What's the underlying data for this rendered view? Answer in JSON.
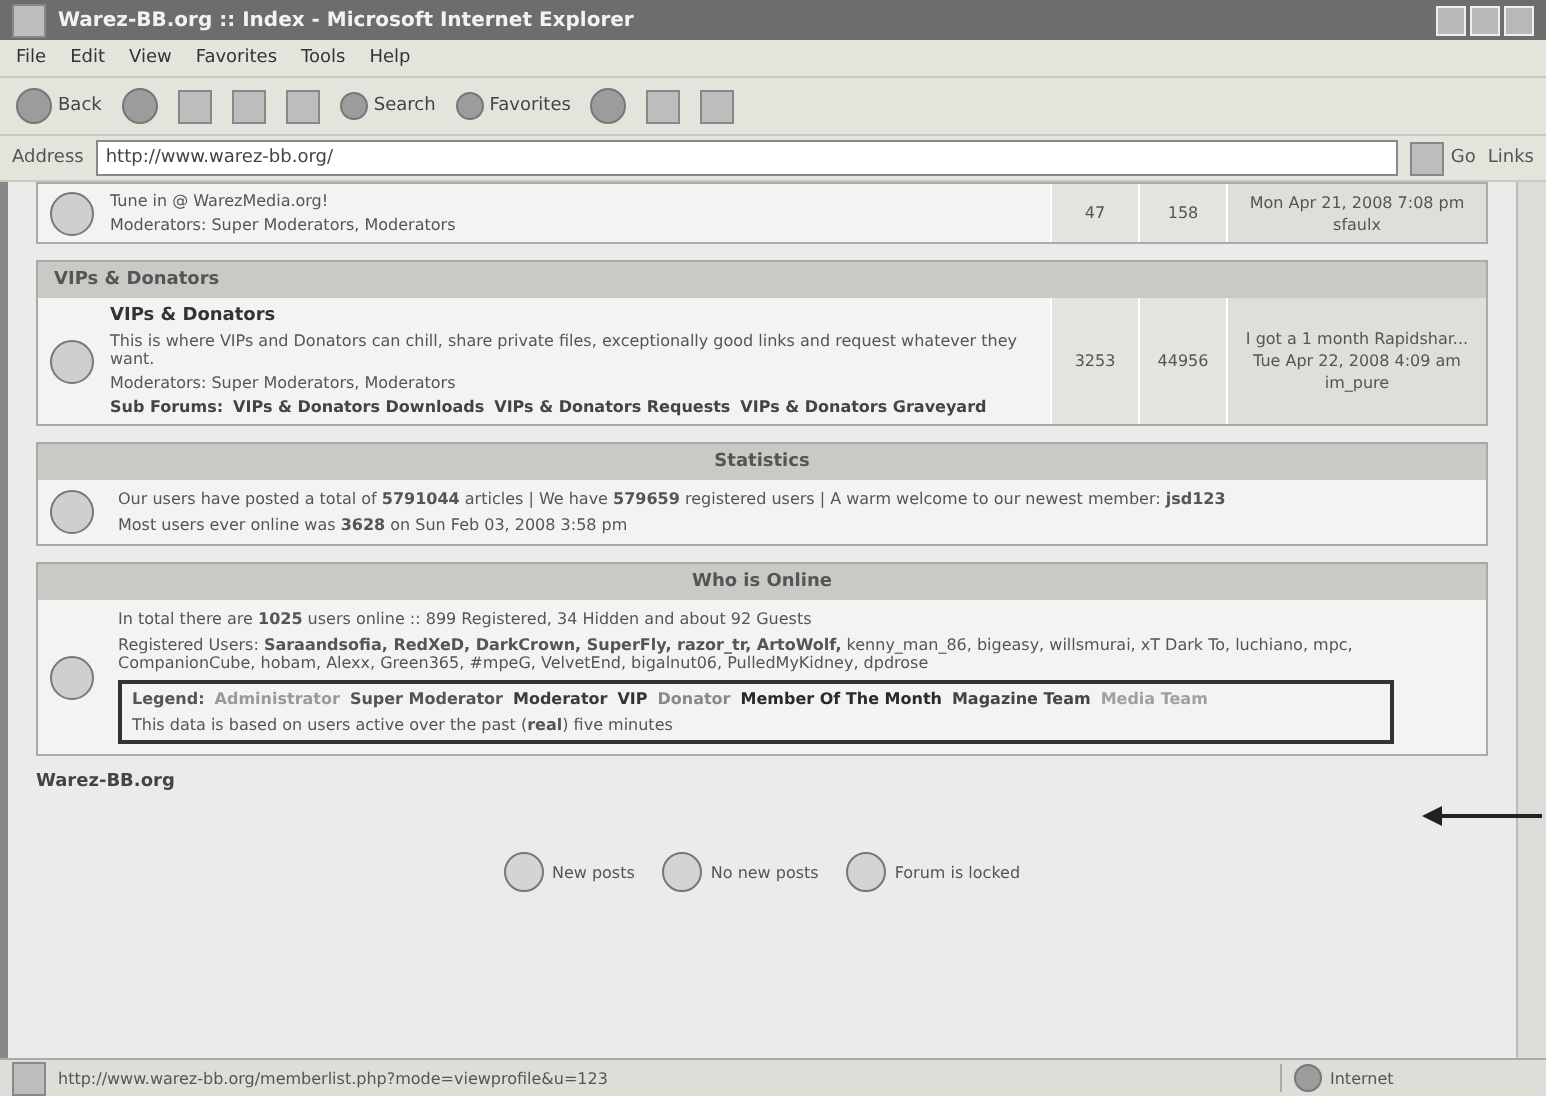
{
  "window": {
    "title": "Warez-BB.org :: Index - Microsoft Internet Explorer"
  },
  "menu": [
    "File",
    "Edit",
    "View",
    "Favorites",
    "Tools",
    "Help"
  ],
  "toolbar": {
    "back": "Back",
    "search": "Search",
    "favorites": "Favorites"
  },
  "address_bar": {
    "label": "Address",
    "value": "http://www.warez-bb.org/",
    "go": "Go",
    "links": "Links"
  },
  "partial_forum": {
    "description": "Tune in @ WarezMedia.org!",
    "moderators": "Moderators: Super Moderators, Moderators",
    "topics": "47",
    "posts": "158",
    "last_post_date": "Mon Apr 21, 2008 7:08 pm",
    "last_post_user": "sfaulx"
  },
  "category": {
    "title": "VIPs & Donators"
  },
  "forum": {
    "name": "VIPs & Donators",
    "description": "This is where VIPs and Donators can chill, share private files, exceptionally good links and request whatever they want.",
    "moderators": "Moderators: Super Moderators, Moderators",
    "sub_label": "Sub Forums:",
    "sub_forums": [
      "VIPs & Donators Downloads",
      "VIPs & Donators Requests",
      "VIPs & Donators Graveyard"
    ],
    "topics": "3253",
    "posts": "44956",
    "last_post_title": "I got a 1 month Rapidshar...",
    "last_post_date": "Tue Apr 22, 2008 4:09 am",
    "last_post_user": "im_pure"
  },
  "statistics": {
    "title": "Statistics",
    "lines": [
      "Our users have posted a total of **5791044** articles | We have **579659** registered users | A warm welcome to our newest member: **jsd123**",
      "Most users ever online was **3628** on Sun Feb 03, 2008 3:58 pm"
    ]
  },
  "who_is_online": {
    "title": "Who is Online",
    "total": "In total there are **1025** users online :: 899 Registered, 34 Hidden and about 92 Guests",
    "registered": "Registered Users: **Saraandsofia, RedXeD, DarkCrown, SuperFly, razor_tr, ArtoWolf,** kenny_man_86, bigeasy, willsmurai, xT Dark To, luchiano, mpc, CompanionCube, hobam, Alexx, Green365, #mpeG, VelvetEnd, bigalnut06, PulledMyKidney, dpdrose",
    "legend_label": "Legend:",
    "legend": [
      {
        "label": "Administrator",
        "color": "#9a9a9a"
      },
      {
        "label": "Super Moderator",
        "color": "#555555"
      },
      {
        "label": "Moderator",
        "color": "#3a3a3a"
      },
      {
        "label": "VIP",
        "color": "#333333"
      },
      {
        "label": "Donator",
        "color": "#8a8a8a"
      },
      {
        "label": "Member Of The Month",
        "color": "#2a2a2a"
      },
      {
        "label": "Magazine Team",
        "color": "#444444"
      },
      {
        "label": "Media Team",
        "color": "#a0a0a0"
      }
    ],
    "note": "This data is based on users active over the past (**real**) five minutes"
  },
  "site_name": "Warez-BB.org",
  "icon_legend": [
    "New posts",
    "No new posts",
    "Forum is locked"
  ],
  "status_bar": {
    "url": "http://www.warez-bb.org/memberlist.php?mode=viewprofile&u=123",
    "zone": "Internet"
  }
}
